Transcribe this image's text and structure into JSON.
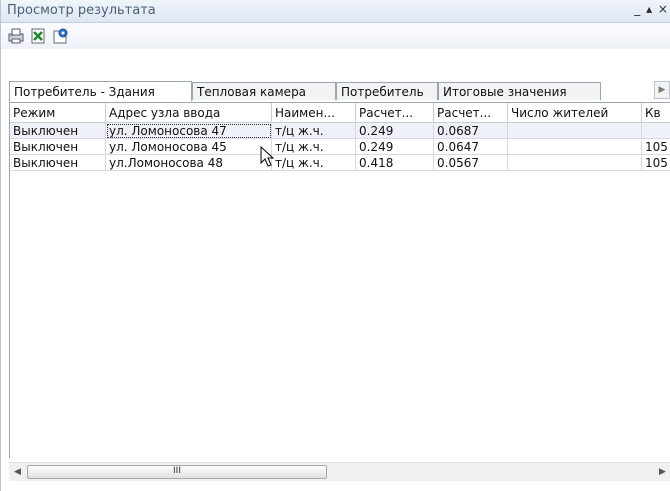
{
  "window": {
    "title": "Просмотр результата",
    "controls": "_ ▴ ×"
  },
  "toolbar": {
    "icons": [
      "print-icon",
      "export-excel-icon",
      "settings-icon"
    ]
  },
  "tabs": [
    {
      "label": "Потребитель - Здания",
      "active": true
    },
    {
      "label": "Тепловая камера",
      "active": false
    },
    {
      "label": "Потребитель",
      "active": false
    },
    {
      "label": "Итоговые значения",
      "active": false
    }
  ],
  "tab_scroll_icon": "chevron-right-icon",
  "table": {
    "columns": [
      "Режим",
      "Адрес узла ввода",
      "Наимен...",
      "Расчет...",
      "Расчет...",
      "Число жителей",
      "Кв"
    ],
    "rows": [
      [
        "Выключен",
        "ул. Ломоносова 47",
        "т/ц ж.ч.",
        "0.249",
        "0.0687",
        "",
        ""
      ],
      [
        "Выключен",
        "ул. Ломоносова 45",
        "т/ц ж.ч.",
        "0.249",
        "0.0647",
        "",
        "105"
      ],
      [
        "Выключен",
        "ул.Ломоносова 48",
        "т/ц ж.ч.",
        "0.418",
        "0.0567",
        "",
        "105"
      ]
    ],
    "selected_row": 0
  },
  "hscroll": {
    "thumb_grip": "III"
  },
  "colors": {
    "title_text": "#4c5f7a",
    "border": "#9aa6b6",
    "selected_row": "#eef2f8"
  }
}
